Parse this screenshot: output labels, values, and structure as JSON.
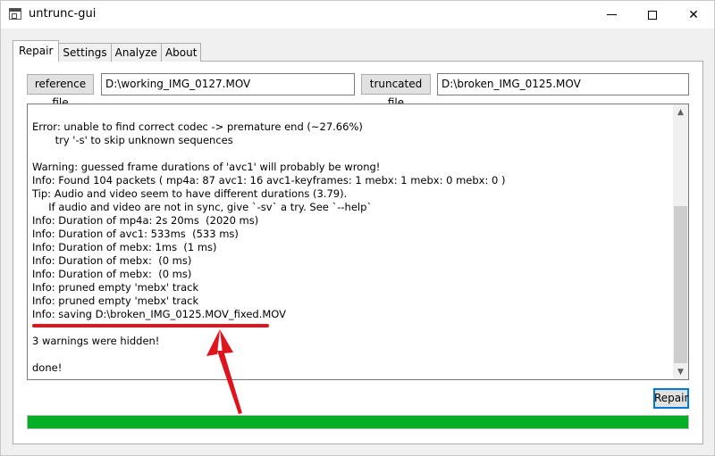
{
  "window": {
    "title": "untrunc-gui",
    "minimize_icon": "minimize-icon",
    "maximize_icon": "maximize-icon",
    "close_icon": "close-icon",
    "close_glyph": "✕"
  },
  "tabs": [
    {
      "label": "Repair",
      "active": true
    },
    {
      "label": "Settings",
      "active": false
    },
    {
      "label": "Analyze",
      "active": false
    },
    {
      "label": "About",
      "active": false
    }
  ],
  "repair": {
    "reference_button": "reference file",
    "reference_value": "D:\\working_IMG_0127.MOV",
    "truncated_button": "truncated file",
    "truncated_value": "D:\\broken_IMG_0125.MOV",
    "log_lines": [
      "Error: unable to find correct codec -> premature end (~27.66%)",
      "       try '-s' to skip unknown sequences",
      "",
      "Warning: guessed frame durations of 'avc1' will probably be wrong!",
      "Info: Found 104 packets ( mp4a: 87 avc1: 16 avc1-keyframes: 1 mebx: 1 mebx: 0 mebx: 0 )",
      "Tip: Audio and video seem to have different durations (3.79).",
      "     If audio and video are not in sync, give `-sv` a try. See `--help`",
      "Info: Duration of mp4a: 2s 20ms  (2020 ms)",
      "Info: Duration of avc1: 533ms  (533 ms)",
      "Info: Duration of mebx: 1ms  (1 ms)",
      "Info: Duration of mebx:  (0 ms)",
      "Info: Duration of mebx:  (0 ms)",
      "Info: pruned empty 'mebx' track",
      "Info: pruned empty 'mebx' track",
      "Info: saving D:\\broken_IMG_0125.MOV_fixed.MOV",
      "",
      "3 warnings were hidden!",
      "",
      "done!"
    ],
    "repair_button": "Repair",
    "progress_fraction": 1.0,
    "progress_color": "#06b025"
  },
  "annotations": {
    "highlight_color": "#e0141e",
    "underline_target": "Info: saving D:\\broken_IMG_0125.MOV_fixed.MOV",
    "arrow_icon": "red-arrow-up-icon"
  },
  "scrollbar": {
    "up_glyph": "▲",
    "down_glyph": "▼"
  }
}
